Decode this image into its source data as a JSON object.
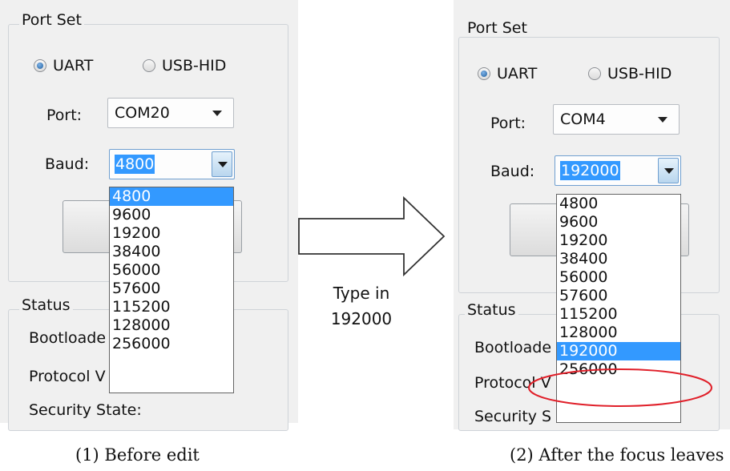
{
  "left": {
    "port_set_label": "Port Set",
    "radio_uart": "UART",
    "radio_usb": "USB-HID",
    "port_label": "Port:",
    "port_value": "COM20",
    "baud_label": "Baud:",
    "baud_value": "4800",
    "status_label": "Status",
    "status_rows": [
      "Bootloade",
      "Protocol V",
      "Security State:"
    ],
    "dropdown": [
      "4800",
      "9600",
      "19200",
      "38400",
      "56000",
      "57600",
      "115200",
      "128000",
      "256000"
    ],
    "caption": "(1) Before edit"
  },
  "middle": {
    "line1": "Type in",
    "line2": "192000"
  },
  "right": {
    "port_set_label": "Port Set",
    "radio_uart": "UART",
    "radio_usb": "USB-HID",
    "port_label": "Port:",
    "port_value": "COM4",
    "baud_label": "Baud:",
    "baud_value": "192000",
    "status_label": "Status",
    "status_rows": [
      "Bootloade",
      "Protocol V",
      "Security S"
    ],
    "dropdown": [
      "4800",
      "9600",
      "19200",
      "38400",
      "56000",
      "57600",
      "115200",
      "128000",
      "192000",
      "256000"
    ],
    "caption": "(2) After the focus leaves"
  },
  "colors": {
    "selection": "#3399ff",
    "highlight_ellipse": "#e0202a",
    "panel_bg": "#f0f0f0"
  }
}
